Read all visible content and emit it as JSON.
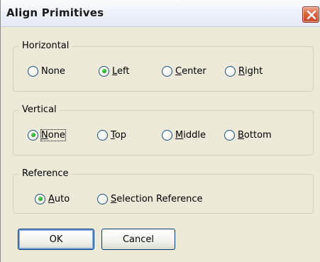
{
  "window": {
    "title": "Align Primitives"
  },
  "horizontal": {
    "legend": "Horizontal",
    "options": [
      {
        "pre": "",
        "mn": "",
        "post": "None",
        "checked": false
      },
      {
        "pre": "",
        "mn": "L",
        "post": "eft",
        "checked": true
      },
      {
        "pre": "",
        "mn": "C",
        "post": "enter",
        "checked": false
      },
      {
        "pre": "",
        "mn": "R",
        "post": "ight",
        "checked": false
      }
    ]
  },
  "vertical": {
    "legend": "Vertical",
    "options": [
      {
        "pre": "",
        "mn": "N",
        "post": "one",
        "checked": true
      },
      {
        "pre": "",
        "mn": "T",
        "post": "op",
        "checked": false
      },
      {
        "pre": "",
        "mn": "M",
        "post": "iddle",
        "checked": false
      },
      {
        "pre": "",
        "mn": "B",
        "post": "ottom",
        "checked": false
      }
    ]
  },
  "reference": {
    "legend": "Reference",
    "options": [
      {
        "pre": "",
        "mn": "A",
        "post": "uto",
        "checked": true
      },
      {
        "pre": "",
        "mn": "S",
        "post": "election Reference",
        "checked": false
      }
    ]
  },
  "buttons": {
    "ok": "OK",
    "cancel": "Cancel"
  },
  "icons": {
    "close": "close-icon"
  },
  "colors": {
    "close_button": "#dd6343",
    "radio_dot": "#21a121",
    "button_border": "#003c74"
  }
}
